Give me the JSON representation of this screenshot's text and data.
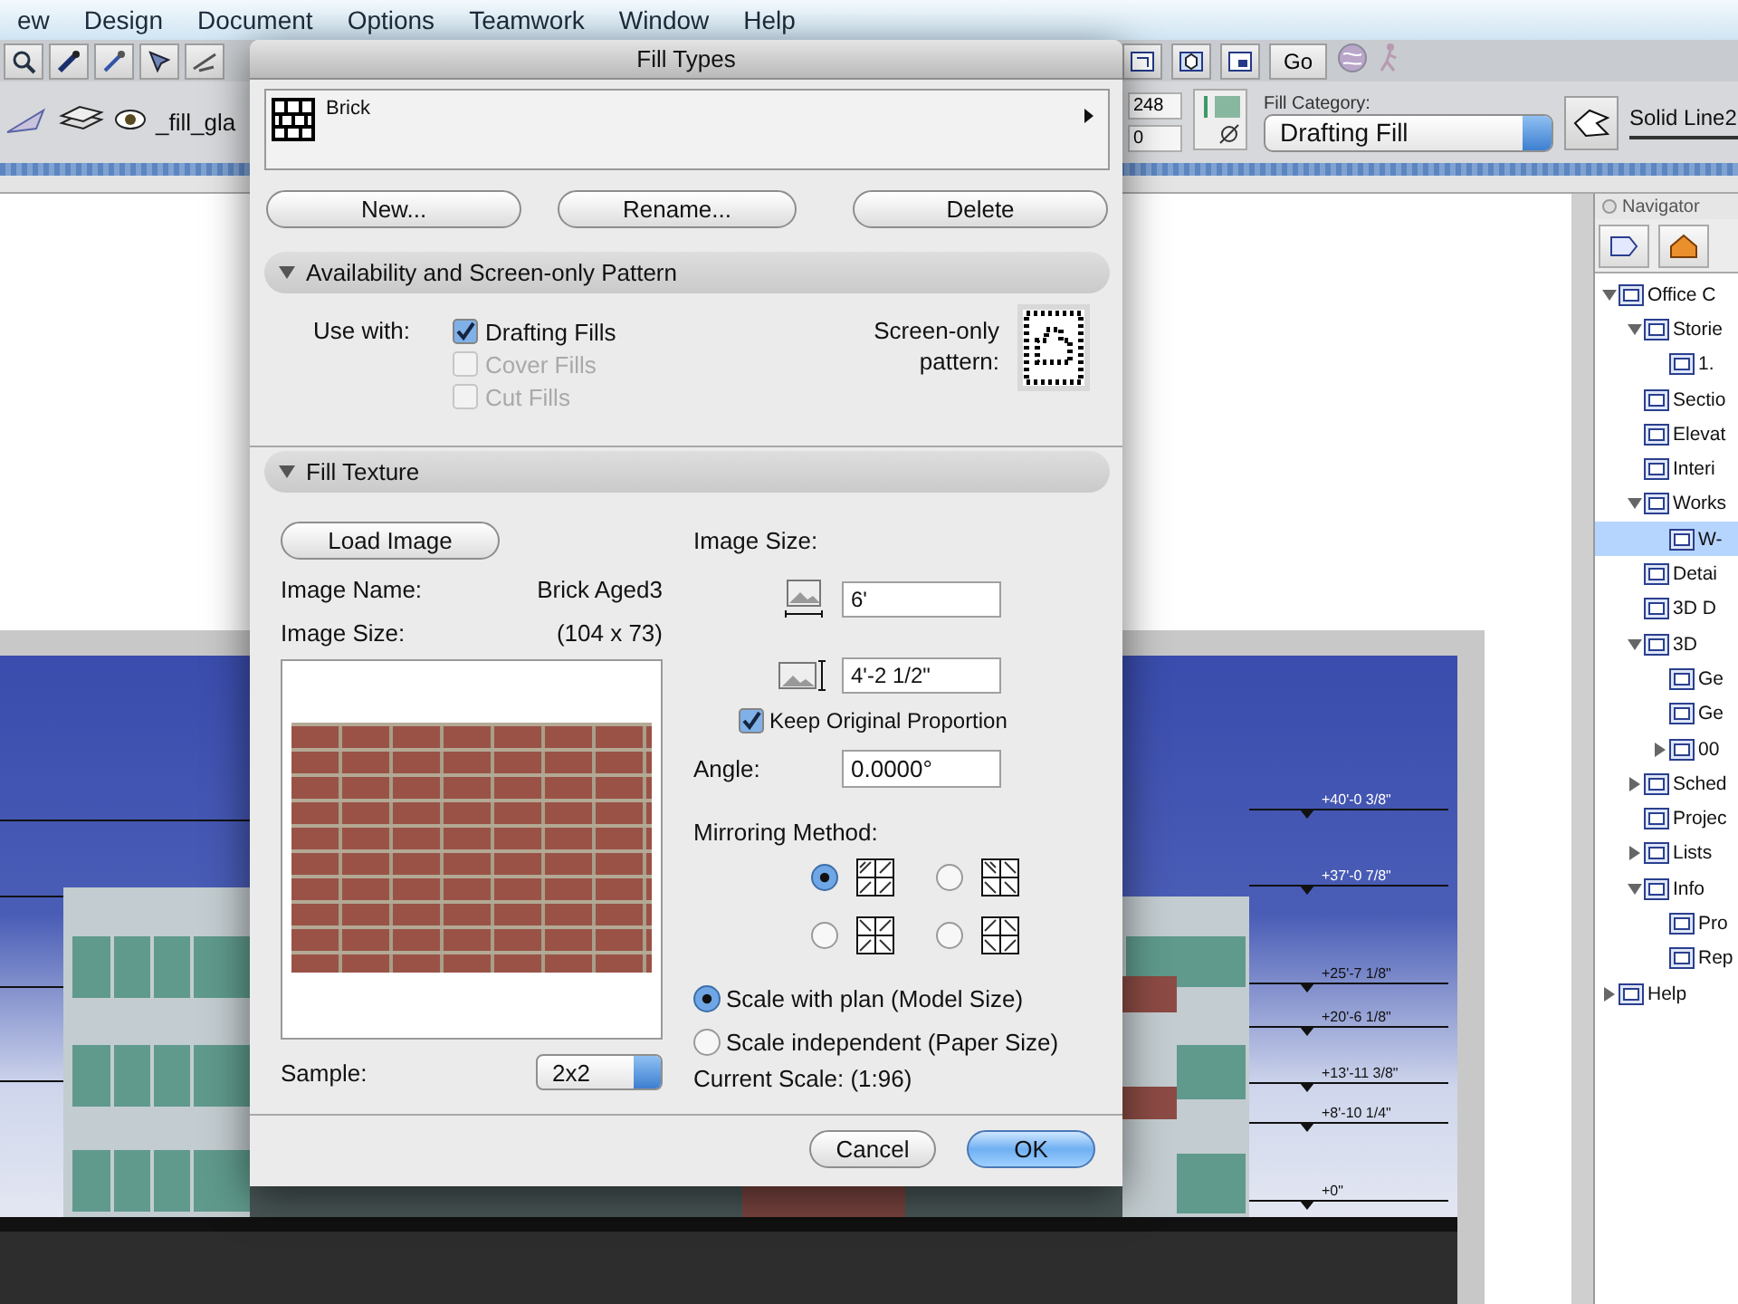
{
  "menu_bar": {
    "items": [
      "ew",
      "Design",
      "Document",
      "Options",
      "Teamwork",
      "Window",
      "Help"
    ]
  },
  "toolbar": {
    "go": "Go",
    "layer": "_fill_gla",
    "number_fields": [
      "248",
      "0"
    ],
    "fill_category_label": "Fill Category:",
    "fill_category": "Drafting Fill",
    "line_type": "Solid Line2"
  },
  "elevation": {
    "level_labels": [
      "+40'-0 3/8\"",
      "+37'-0 7/8\"",
      "+25'-7 1/8\"",
      "+20'-6 1/8\"",
      "+13'-11 3/8\"",
      "+8'-10 1/4\"",
      "+0\""
    ]
  },
  "navigator": {
    "title": "Navigator",
    "tree": [
      {
        "label": "Office C",
        "expanded": true,
        "selected": false,
        "children": [
          {
            "label": "Storie",
            "expanded": true,
            "selected": false,
            "children": [
              {
                "label": "1.",
                "selected": false
              }
            ]
          },
          {
            "label": "Sectio",
            "selected": false
          },
          {
            "label": "Elevat",
            "selected": false
          },
          {
            "label": "Interi",
            "selected": false
          },
          {
            "label": "Works",
            "expanded": true,
            "selected": false,
            "children": [
              {
                "label": "W-",
                "selected": true
              }
            ]
          },
          {
            "label": "Detai",
            "selected": false
          },
          {
            "label": "3D D",
            "selected": false
          },
          {
            "label": "3D",
            "expanded": true,
            "selected": false,
            "children": [
              {
                "label": "Ge",
                "selected": false
              },
              {
                "label": "Ge",
                "selected": false
              },
              {
                "label": "00",
                "expanded": false,
                "selected": false
              }
            ]
          },
          {
            "label": "Sched",
            "expanded": false,
            "selected": false
          },
          {
            "label": "Projec",
            "selected": false
          },
          {
            "label": "Lists",
            "expanded": false,
            "selected": false
          },
          {
            "label": "Info",
            "expanded": true,
            "selected": false,
            "children": [
              {
                "label": "Pro",
                "selected": false
              },
              {
                "label": "Rep",
                "selected": false
              }
            ]
          }
        ]
      },
      {
        "label": "Help",
        "expanded": false,
        "selected": false
      }
    ]
  },
  "dialog": {
    "title": "Fill Types",
    "fill_name": "Brick",
    "buttons": [
      "New...",
      "Rename...",
      "Delete"
    ],
    "sections": [
      {
        "title": "Availability and Screen-only Pattern",
        "expanded": true
      },
      {
        "title": "Fill Texture",
        "expanded": true
      }
    ],
    "use_with_label": "Use with:",
    "use_with": [
      {
        "label": "Drafting Fills",
        "checked": true,
        "disabled": false
      },
      {
        "label": "Cover Fills",
        "checked": false,
        "disabled": true
      },
      {
        "label": "Cut Fills",
        "checked": false,
        "disabled": true
      }
    ],
    "screen_pattern_label": "Screen-only pattern:",
    "load_image_button": "Load Image",
    "image_name_label": "Image Name:",
    "image_name": "Brick Aged3",
    "image_size_label": "Image Size:",
    "image_size": "(104 x 73)",
    "sample_label": "Sample:",
    "sample": "2x2",
    "size_label": "Image Size:",
    "width": "6'",
    "height": "4'-2 1/2\"",
    "keep_proportion": {
      "label": "Keep Original Proportion",
      "checked": true
    },
    "angle_label": "Angle:",
    "angle": "0.0000°",
    "mirroring_label": "Mirroring Method:",
    "mirroring": [
      {
        "selected": true
      },
      {
        "selected": false
      },
      {
        "selected": false
      },
      {
        "selected": false
      }
    ],
    "scale_options": [
      {
        "label": "Scale with plan (Model Size)",
        "selected": true
      },
      {
        "label": "Scale independent (Paper Size)",
        "selected": false
      }
    ],
    "current_scale": "Current Scale: (1:96)",
    "cancel": "Cancel",
    "ok": "OK"
  }
}
